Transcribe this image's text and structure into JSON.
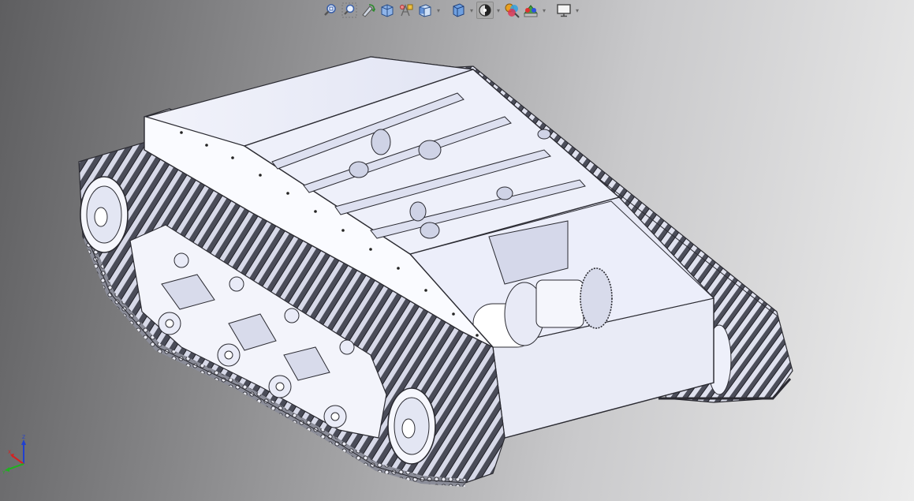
{
  "app": {
    "view": "graphics-area",
    "background_colors": [
      "#5e5e60",
      "#ececec"
    ],
    "model_shade": "#eceefb",
    "model_edge": "#333338"
  },
  "heads_up_toolbar": {
    "items": [
      {
        "icon": "zoom-to-fit-icon"
      },
      {
        "icon": "zoom-to-area-icon"
      },
      {
        "icon": "previous-view-icon"
      },
      {
        "icon": "section-view-icon"
      },
      {
        "icon": "dynamic-annotation-views-icon"
      },
      {
        "icon": "view-orientation-icon",
        "dropdown": true
      },
      {
        "icon": "display-style-icon",
        "dropdown": true
      },
      {
        "icon": "hide-show-items-icon",
        "dropdown": true,
        "active": true
      },
      {
        "icon": "edit-appearance-icon"
      },
      {
        "icon": "apply-scene-icon",
        "dropdown": true
      },
      {
        "icon": "view-settings-icon",
        "dropdown": true
      }
    ]
  },
  "triad": {
    "axes": [
      "Z",
      "X",
      "Y"
    ],
    "colors": {
      "x": "#d62020",
      "y": "#20b020",
      "z": "#2040d0"
    }
  }
}
